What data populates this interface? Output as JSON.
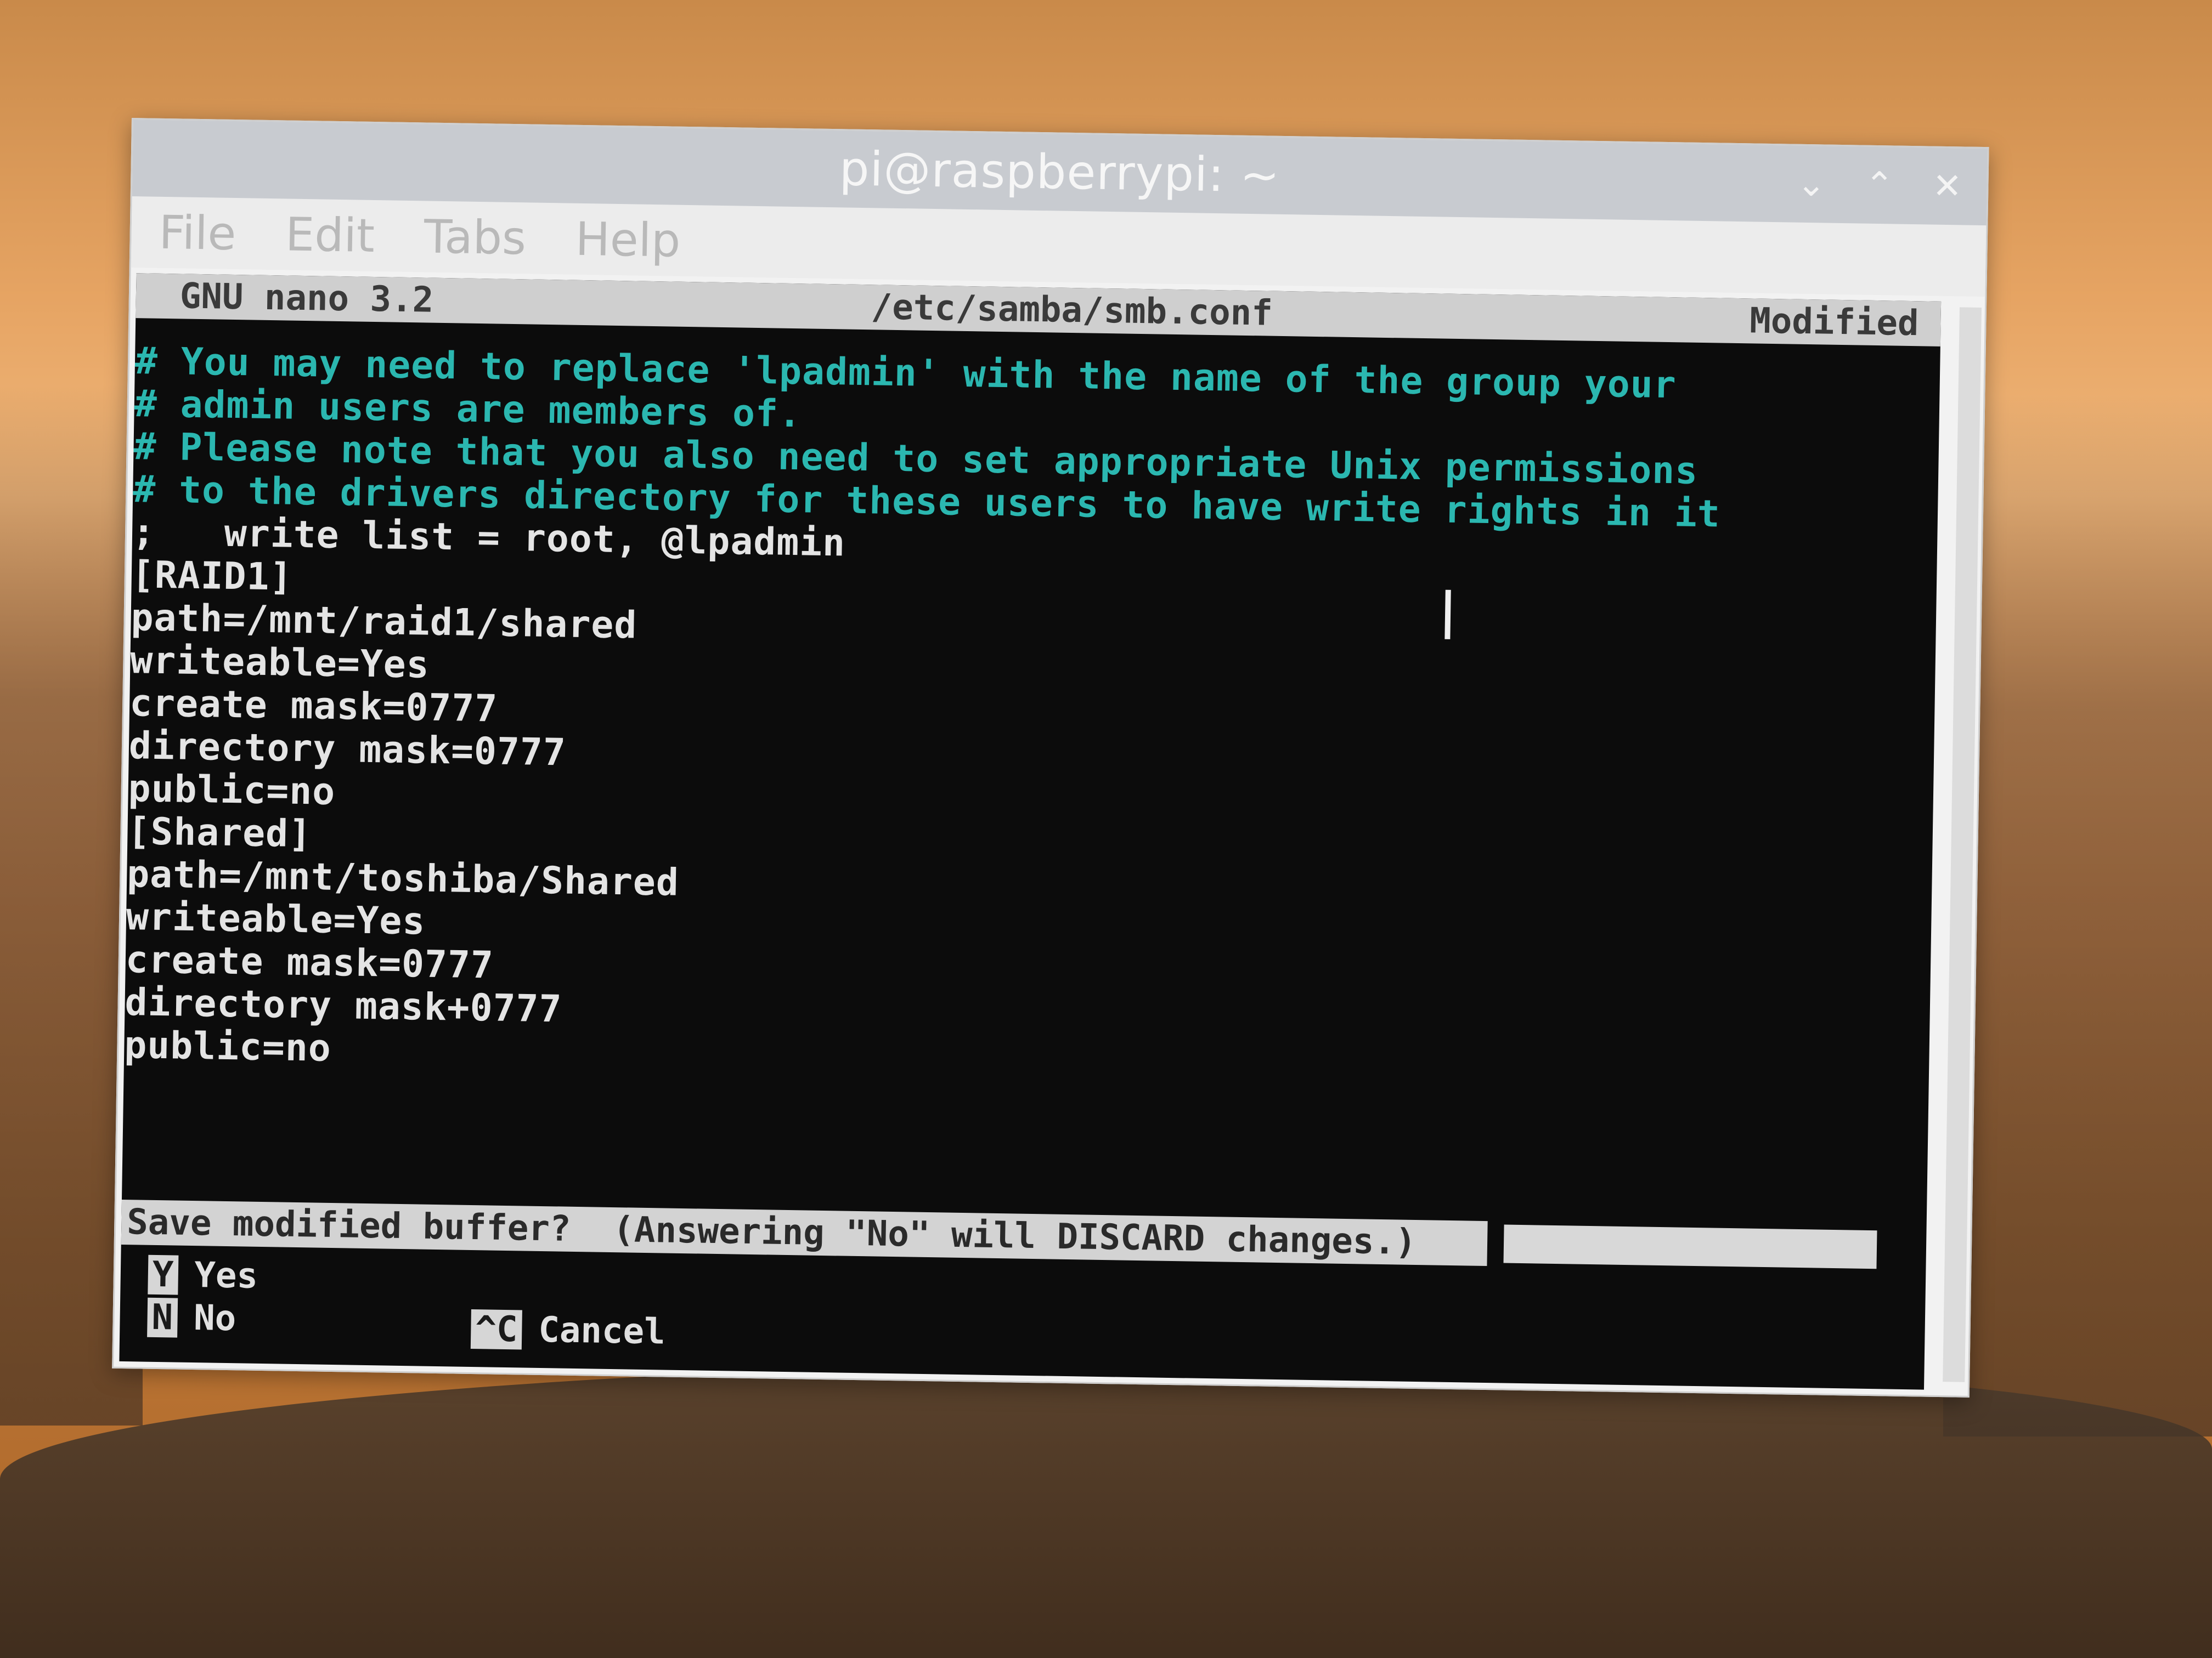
{
  "window": {
    "title": "pi@raspberrypi: ~",
    "controls": [
      "⌄",
      "⌃",
      "✕"
    ]
  },
  "menu": {
    "items": [
      "File",
      "Edit",
      "Tabs",
      "Help"
    ]
  },
  "nano": {
    "version": "GNU nano 3.2",
    "filename": "/etc/samba/smb.conf",
    "status": "Modified"
  },
  "editor": {
    "lines": [
      {
        "text": "# You may need to replace 'lpadmin' with the name of the group your",
        "kind": "comment"
      },
      {
        "text": "# admin users are members of.",
        "kind": "comment"
      },
      {
        "text": "# Please note that you also need to set appropriate Unix permissions",
        "kind": "comment"
      },
      {
        "text": "# to the drivers directory for these users to have write rights in it",
        "kind": "comment"
      },
      {
        "text": ";   write list = root, @lpadmin",
        "kind": "normal"
      },
      {
        "text": "[RAID1]",
        "kind": "normal"
      },
      {
        "text": "path=/mnt/raid1/shared",
        "kind": "normal"
      },
      {
        "text": "writeable=Yes",
        "kind": "normal"
      },
      {
        "text": "create mask=0777",
        "kind": "normal"
      },
      {
        "text": "directory mask=0777",
        "kind": "normal"
      },
      {
        "text": "public=no",
        "kind": "normal"
      },
      {
        "text": "[Shared]",
        "kind": "normal"
      },
      {
        "text": "path=/mnt/toshiba/Shared",
        "kind": "normal"
      },
      {
        "text": "writeable=Yes",
        "kind": "normal"
      },
      {
        "text": "create mask=0777",
        "kind": "normal"
      },
      {
        "text": "directory mask+0777",
        "kind": "normal"
      },
      {
        "text": "public=no",
        "kind": "normal"
      }
    ]
  },
  "prompt": {
    "question": "Save modified buffer?  (Answering \"No\" will DISCARD changes.)",
    "input_value": ""
  },
  "options": {
    "yes": {
      "key": "Y",
      "label": "Yes"
    },
    "no": {
      "key": "N",
      "label": "No"
    },
    "cancel": {
      "key": "^C",
      "label": "Cancel"
    }
  },
  "colors": {
    "comment": "#2bb7b0",
    "text": "#e4e4e4",
    "terminal_bg": "#0c0c0c"
  }
}
